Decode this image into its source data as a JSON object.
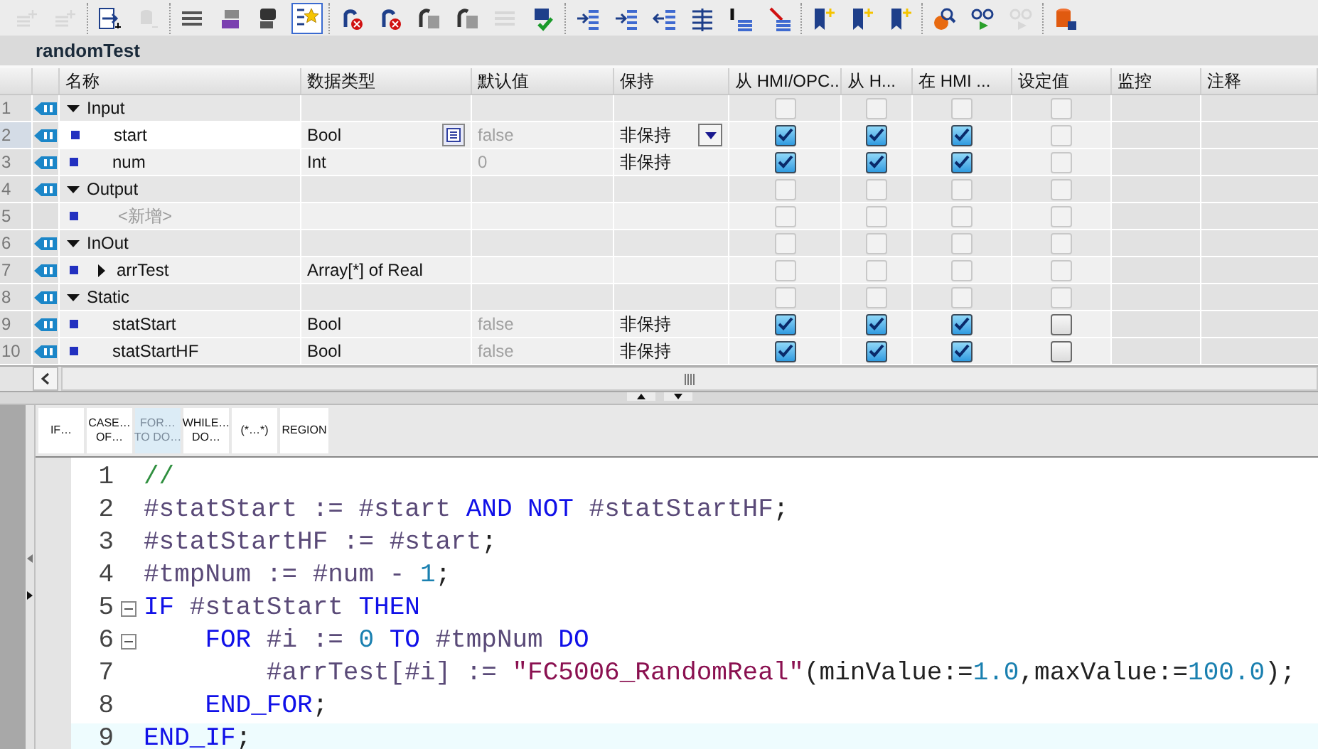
{
  "toolbar": {
    "groups": [
      [
        {
          "kind": "sparkle",
          "disabled": true,
          "selected": false
        },
        {
          "kind": "sparkle",
          "disabled": true,
          "selected": false
        }
      ],
      [
        {
          "kind": "export",
          "disabled": false,
          "selected": false
        },
        {
          "kind": "cylinder",
          "disabled": true,
          "selected": false
        }
      ],
      [
        {
          "kind": "lines",
          "disabled": false,
          "selected": false
        },
        {
          "kind": "tag",
          "disabled": false,
          "selected": false
        },
        {
          "kind": "chat",
          "disabled": false,
          "selected": false
        },
        {
          "kind": "star",
          "disabled": false,
          "selected": true
        }
      ],
      [
        {
          "kind": "arrowx",
          "disabled": false,
          "selected": false
        },
        {
          "kind": "arrowx",
          "disabled": false,
          "selected": false
        },
        {
          "kind": "arrowbox",
          "disabled": false,
          "selected": false
        },
        {
          "kind": "arrowbox",
          "disabled": false,
          "selected": false
        },
        {
          "kind": "lines",
          "disabled": true,
          "selected": false
        },
        {
          "kind": "check",
          "disabled": false,
          "selected": false
        }
      ],
      [
        {
          "kind": "indent",
          "disabled": false,
          "selected": false
        },
        {
          "kind": "indent",
          "disabled": false,
          "selected": false
        },
        {
          "kind": "outdent",
          "disabled": false,
          "selected": false
        },
        {
          "kind": "columns",
          "disabled": false,
          "selected": false
        },
        {
          "kind": "bars",
          "disabled": false,
          "selected": false
        },
        {
          "kind": "barsx",
          "disabled": false,
          "selected": false
        }
      ],
      [
        {
          "kind": "bookmark",
          "disabled": false,
          "selected": false
        },
        {
          "kind": "bookmark",
          "disabled": false,
          "selected": false
        },
        {
          "kind": "bookmark",
          "disabled": false,
          "selected": false
        }
      ],
      [
        {
          "kind": "search",
          "disabled": false,
          "selected": false
        },
        {
          "kind": "glasses",
          "disabled": false,
          "selected": false
        },
        {
          "kind": "glasses",
          "disabled": true,
          "selected": false
        }
      ],
      [
        {
          "kind": "database",
          "disabled": false,
          "selected": false
        }
      ]
    ]
  },
  "block_title": "randomTest",
  "table": {
    "columns": [
      "名称",
      "数据类型",
      "默认值",
      "保持",
      "从 HMI/OPC..",
      "从 H...",
      "在 HMI ...",
      "设定值",
      "监控",
      "注释"
    ],
    "rows": [
      {
        "number": "1",
        "kind": "section",
        "expanded": true,
        "interface": true,
        "name": "Input",
        "selected": false,
        "checks": [
          {
            "checked": false,
            "disabled": true
          },
          {
            "checked": false,
            "disabled": true
          },
          {
            "checked": false,
            "disabled": true
          },
          {
            "checked": false,
            "disabled": true
          }
        ]
      },
      {
        "number": "2",
        "kind": "member",
        "interface": true,
        "name": "start",
        "type": "Bool",
        "default": "false",
        "retain": "非保持",
        "selected": true,
        "checks": [
          {
            "checked": true,
            "disabled": false
          },
          {
            "checked": true,
            "disabled": false
          },
          {
            "checked": true,
            "disabled": false
          },
          {
            "checked": false,
            "disabled": true
          }
        ]
      },
      {
        "number": "3",
        "kind": "member",
        "interface": true,
        "name": "num",
        "type": "Int",
        "default": "0",
        "retain": "非保持",
        "selected": false,
        "checks": [
          {
            "checked": true,
            "disabled": false
          },
          {
            "checked": true,
            "disabled": false
          },
          {
            "checked": true,
            "disabled": false
          },
          {
            "checked": false,
            "disabled": true
          }
        ]
      },
      {
        "number": "4",
        "kind": "section",
        "expanded": true,
        "interface": true,
        "name": "Output",
        "selected": false,
        "checks": [
          {
            "checked": false,
            "disabled": true
          },
          {
            "checked": false,
            "disabled": true
          },
          {
            "checked": false,
            "disabled": true
          },
          {
            "checked": false,
            "disabled": true
          }
        ]
      },
      {
        "number": "5",
        "kind": "add",
        "interface": false,
        "name": "<新增>",
        "selected": false,
        "checks": [
          {
            "checked": false,
            "disabled": true
          },
          {
            "checked": false,
            "disabled": true
          },
          {
            "checked": false,
            "disabled": true
          },
          {
            "checked": false,
            "disabled": true
          }
        ]
      },
      {
        "number": "6",
        "kind": "section",
        "expanded": true,
        "interface": true,
        "name": "InOut",
        "selected": false,
        "checks": [
          {
            "checked": false,
            "disabled": true
          },
          {
            "checked": false,
            "disabled": true
          },
          {
            "checked": false,
            "disabled": true
          },
          {
            "checked": false,
            "disabled": true
          }
        ]
      },
      {
        "number": "7",
        "kind": "array",
        "expanded": false,
        "interface": true,
        "name": "arrTest",
        "type": "Array[*] of Real",
        "selected": false,
        "checks": [
          {
            "checked": false,
            "disabled": true
          },
          {
            "checked": false,
            "disabled": true
          },
          {
            "checked": false,
            "disabled": true
          },
          {
            "checked": false,
            "disabled": true
          }
        ]
      },
      {
        "number": "8",
        "kind": "section",
        "expanded": true,
        "interface": true,
        "name": "Static",
        "selected": false,
        "checks": [
          {
            "checked": false,
            "disabled": true
          },
          {
            "checked": false,
            "disabled": true
          },
          {
            "checked": false,
            "disabled": true
          },
          {
            "checked": false,
            "disabled": true
          }
        ]
      },
      {
        "number": "9",
        "kind": "member",
        "interface": true,
        "name": "statStart",
        "type": "Bool",
        "default": "false",
        "retain": "非保持",
        "selected": false,
        "checks": [
          {
            "checked": true,
            "disabled": false
          },
          {
            "checked": true,
            "disabled": false
          },
          {
            "checked": true,
            "disabled": false
          },
          {
            "checked": false,
            "disabled": false
          }
        ]
      },
      {
        "number": "10",
        "kind": "member",
        "interface": true,
        "name": "statStartHF",
        "type": "Bool",
        "default": "false",
        "retain": "非保持",
        "selected": false,
        "checks": [
          {
            "checked": true,
            "disabled": false
          },
          {
            "checked": true,
            "disabled": false
          },
          {
            "checked": true,
            "disabled": false
          },
          {
            "checked": false,
            "disabled": false
          }
        ]
      }
    ]
  },
  "snippets": [
    {
      "lines": [
        "IF…"
      ],
      "selected": false
    },
    {
      "lines": [
        "CASE…",
        "OF…"
      ],
      "selected": false
    },
    {
      "lines": [
        "FOR…",
        "TO DO…"
      ],
      "selected": true
    },
    {
      "lines": [
        "WHILE…",
        "DO…"
      ],
      "selected": false
    },
    {
      "lines": [
        "(*…*)"
      ],
      "selected": false
    },
    {
      "lines": [
        "REGION"
      ],
      "selected": false
    }
  ],
  "code": [
    {
      "number": "1",
      "fold": false,
      "selected": false,
      "tokens": [
        {
          "kind": "comment",
          "text": "//"
        }
      ]
    },
    {
      "number": "2",
      "fold": false,
      "selected": false,
      "tokens": [
        {
          "kind": "var",
          "text": "#statStart := #start "
        },
        {
          "kind": "keyword",
          "text": "AND NOT "
        },
        {
          "kind": "var",
          "text": "#statStartHF"
        },
        {
          "kind": "punct",
          "text": ";"
        }
      ]
    },
    {
      "number": "3",
      "fold": false,
      "selected": false,
      "tokens": [
        {
          "kind": "var",
          "text": "#statStartHF := #start"
        },
        {
          "kind": "punct",
          "text": ";"
        }
      ]
    },
    {
      "number": "4",
      "fold": false,
      "selected": false,
      "tokens": [
        {
          "kind": "var",
          "text": "#tmpNum := #num - "
        },
        {
          "kind": "number",
          "text": "1"
        },
        {
          "kind": "punct",
          "text": ";"
        }
      ]
    },
    {
      "number": "5",
      "fold": true,
      "selected": false,
      "tokens": [
        {
          "kind": "keyword",
          "text": "IF "
        },
        {
          "kind": "var",
          "text": "#statStart "
        },
        {
          "kind": "keyword",
          "text": "THEN"
        }
      ]
    },
    {
      "number": "6",
      "fold": true,
      "selected": false,
      "tokens": [
        {
          "kind": "keyword",
          "text": "    FOR "
        },
        {
          "kind": "var",
          "text": "#i := "
        },
        {
          "kind": "number",
          "text": "0 "
        },
        {
          "kind": "keyword",
          "text": "TO "
        },
        {
          "kind": "var",
          "text": "#tmpNum "
        },
        {
          "kind": "keyword",
          "text": "DO"
        }
      ]
    },
    {
      "number": "7",
      "fold": false,
      "selected": false,
      "tokens": [
        {
          "kind": "var",
          "text": "        #arrTest[#i] := "
        },
        {
          "kind": "string",
          "text": "\"FC5006_RandomReal\""
        },
        {
          "kind": "punct",
          "text": "(minValue:="
        },
        {
          "kind": "number",
          "text": "1.0"
        },
        {
          "kind": "punct",
          "text": ",maxValue:="
        },
        {
          "kind": "number",
          "text": "100.0"
        },
        {
          "kind": "punct",
          "text": ");"
        }
      ]
    },
    {
      "number": "8",
      "fold": false,
      "selected": false,
      "tokens": [
        {
          "kind": "keyword",
          "text": "    END_FOR"
        },
        {
          "kind": "punct",
          "text": ";"
        }
      ]
    },
    {
      "number": "9",
      "fold": false,
      "selected": true,
      "tokens": [
        {
          "kind": "keyword",
          "text": "END_IF"
        },
        {
          "kind": "punct",
          "text": ";"
        }
      ]
    }
  ]
}
